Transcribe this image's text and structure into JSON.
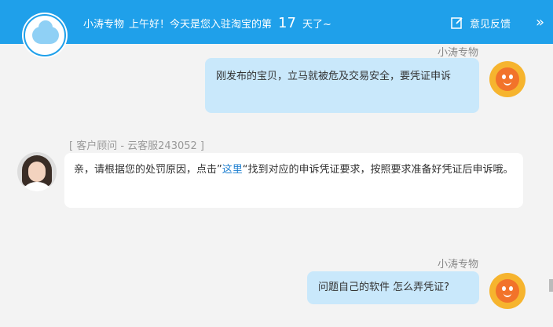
{
  "header": {
    "shop_name": "小涛专物",
    "greeting_prefix": "上午好！今天是您入驻淘宝的第",
    "days": "17",
    "greeting_suffix": "天了~",
    "feedback_label": "意见反馈",
    "expand_icon": "double-chevron-right-icon"
  },
  "messages": [
    {
      "sender": "小涛专物",
      "side": "right",
      "text": "刚发布的宝贝，立马就被危及交易安全，要凭证申诉"
    },
    {
      "sender": "[ 客户顾问  -  云客服243052 ]",
      "side": "left",
      "text_before": "亲，请根据您的处罚原因，点击”",
      "link_text": "这里",
      "text_after": "“找到对应的申诉凭证要求，按照要求准备好凭证后申诉哦。"
    },
    {
      "sender": "小涛专物",
      "side": "right",
      "text": "问题自己的软件 怎么弄凭证?"
    }
  ],
  "colors": {
    "header_bg": "#1fa0ea",
    "my_bubble": "#c9e8fb",
    "their_bubble": "#ffffff",
    "link": "#1e7fd0"
  }
}
